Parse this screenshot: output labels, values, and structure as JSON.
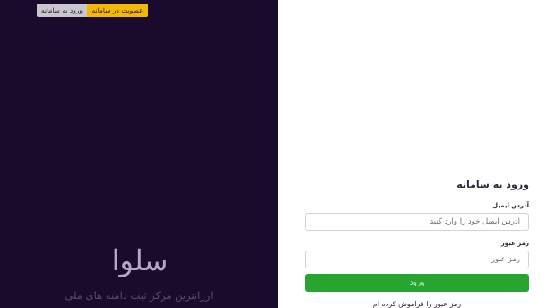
{
  "colors": {
    "panel_bg": "#1a0a2b",
    "accent_yellow": "#f5b800",
    "submit_green": "#27a531"
  },
  "header_tabs": {
    "login_label": "ورود به سامانه",
    "signup_label": "عضویت در سامانه"
  },
  "brand": {
    "logo_text": "سلوا",
    "tagline": "ارزانترین مرکز ثبت دامنه های ملی"
  },
  "login_form": {
    "title": "ورود به سامانه",
    "email_label": "آدرس ایمیل",
    "email_placeholder": "آدرس ایمیل خود را وارد کنید",
    "email_value": "",
    "password_label": "رمز عبور",
    "password_placeholder": "رمز عبور",
    "password_value": "",
    "submit_label": "ورود",
    "forgot_label": "رمز عبور را فراموش کرده ام"
  }
}
